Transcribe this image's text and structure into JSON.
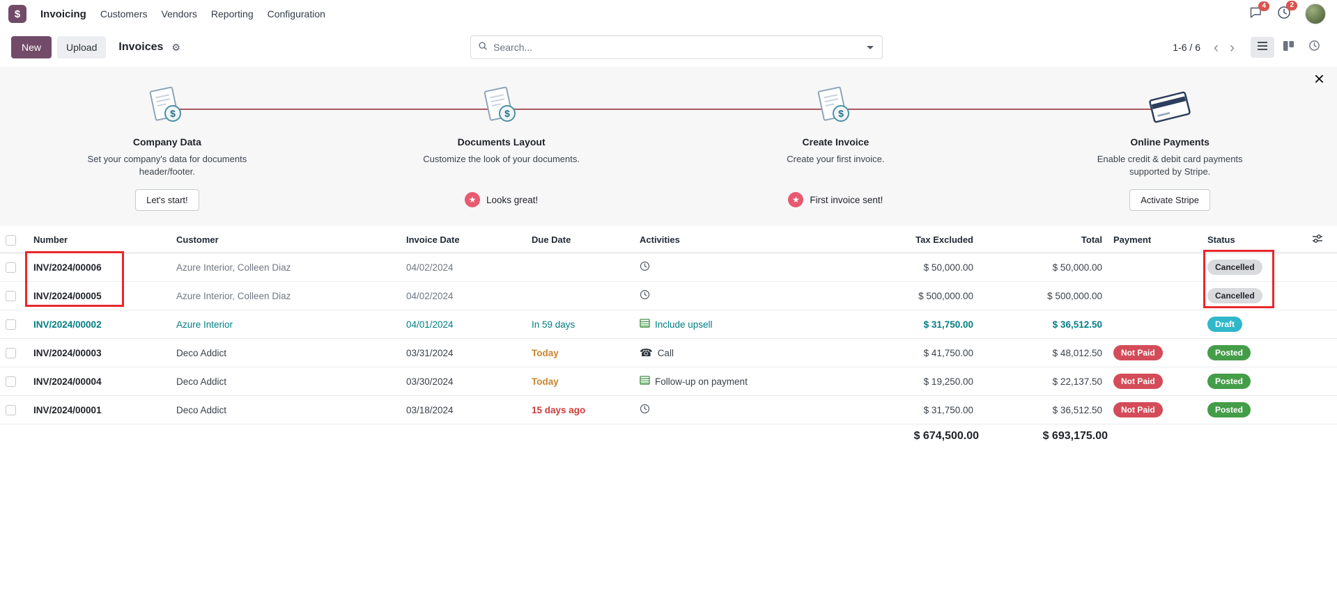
{
  "navbar": {
    "app_name": "Invoicing",
    "menu": [
      "Customers",
      "Vendors",
      "Reporting",
      "Configuration"
    ],
    "messages_badge": "4",
    "activities_badge": "2"
  },
  "control_panel": {
    "new_button": "New",
    "upload_button": "Upload",
    "title": "Invoices",
    "search": {
      "placeholder": "Search..."
    },
    "pager": "1-6 / 6"
  },
  "onboarding": {
    "steps": [
      {
        "title": "Company Data",
        "description": "Set your company's data for documents header/footer.",
        "button": "Let's start!"
      },
      {
        "title": "Documents Layout",
        "description": "Customize the look of your documents.",
        "done_label": "Looks great!"
      },
      {
        "title": "Create Invoice",
        "description": "Create your first invoice.",
        "done_label": "First invoice sent!"
      },
      {
        "title": "Online Payments",
        "description": "Enable credit & debit card payments supported by Stripe.",
        "button": "Activate Stripe"
      }
    ]
  },
  "table": {
    "headers": [
      "Number",
      "Customer",
      "Invoice Date",
      "Due Date",
      "Activities",
      "Tax Excluded",
      "Total",
      "Payment",
      "Status"
    ],
    "rows": [
      {
        "number": "INV/2024/00006",
        "customer": "Azure Interior, Colleen Diaz",
        "invoice_date": "04/02/2024",
        "due_date": "",
        "due_class": "",
        "activity_icon": "clock",
        "activity_label": "",
        "tax_excluded": "$ 50,000.00",
        "total": "$ 50,000.00",
        "payment": "",
        "status": "Cancelled",
        "status_class": "cancelled",
        "row_class": "muted"
      },
      {
        "number": "INV/2024/00005",
        "customer": "Azure Interior, Colleen Diaz",
        "invoice_date": "04/02/2024",
        "due_date": "",
        "due_class": "",
        "activity_icon": "clock",
        "activity_label": "",
        "tax_excluded": "$ 500,000.00",
        "total": "$ 500,000.00",
        "payment": "",
        "status": "Cancelled",
        "status_class": "cancelled",
        "row_class": "muted"
      },
      {
        "number": "INV/2024/00002",
        "customer": "Azure Interior",
        "invoice_date": "04/01/2024",
        "due_date": "In 59 days",
        "due_class": "info",
        "activity_icon": "list",
        "activity_label": "Include upsell",
        "tax_excluded": "$ 31,750.00",
        "total": "$ 36,512.50",
        "payment": "",
        "status": "Draft",
        "status_class": "draft",
        "row_class": "info"
      },
      {
        "number": "INV/2024/00003",
        "customer": "Deco Addict",
        "invoice_date": "03/31/2024",
        "due_date": "Today",
        "due_class": "warning",
        "activity_icon": "phone",
        "activity_label": "Call",
        "tax_excluded": "$ 41,750.00",
        "total": "$ 48,012.50",
        "payment": "Not Paid",
        "status": "Posted",
        "status_class": "posted",
        "row_class": ""
      },
      {
        "number": "INV/2024/00004",
        "customer": "Deco Addict",
        "invoice_date": "03/30/2024",
        "due_date": "Today",
        "due_class": "warning",
        "activity_icon": "list",
        "activity_label": "Follow-up on payment",
        "tax_excluded": "$ 19,250.00",
        "total": "$ 22,137.50",
        "payment": "Not Paid",
        "status": "Posted",
        "status_class": "posted",
        "row_class": ""
      },
      {
        "number": "INV/2024/00001",
        "customer": "Deco Addict",
        "invoice_date": "03/18/2024",
        "due_date": "15 days ago",
        "due_class": "danger",
        "activity_icon": "clock",
        "activity_label": "",
        "tax_excluded": "$ 31,750.00",
        "total": "$ 36,512.50",
        "payment": "Not Paid",
        "status": "Posted",
        "status_class": "posted",
        "row_class": ""
      }
    ],
    "totals": {
      "tax_excluded": "$ 674,500.00",
      "total": "$ 693,175.00"
    }
  },
  "colors": {
    "brand_primary": "#714B67",
    "row_info_teal": "#017E84",
    "due_warning_orange": "#C9842E",
    "due_danger_red": "#CE3B3B",
    "badge_not_paid": "#D44C59",
    "badge_draft": "#2FB7CA",
    "badge_posted": "#449D48",
    "badge_cancelled": "#D8DADD",
    "annotation_red": "#E8272C"
  }
}
